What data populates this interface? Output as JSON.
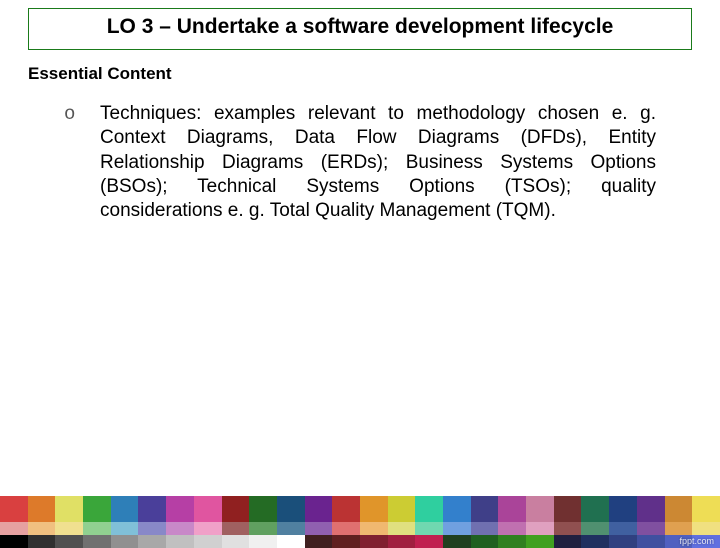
{
  "title": "LO 3 – Undertake a software development lifecycle",
  "subheading": "Essential Content",
  "bullet_marker": "o",
  "bullet_text": "Techniques: examples relevant to methodology chosen e. g. Context Diagrams, Data Flow Diagrams (DFDs), Entity Relationship Diagrams (ERDs); Business Systems Options (BSOs); Technical Systems Options (TSOs); quality considerations e. g. Total Quality Management (TQM).",
  "watermark": "fppt.com",
  "footer_rows": {
    "big": [
      "#d94040",
      "#dd7a2a",
      "#e0e065",
      "#3aa63a",
      "#2e7fb8",
      "#4a3f9a",
      "#b63fa5",
      "#e055a0",
      "#902020",
      "#246b24",
      "#1a4f7a",
      "#6a238f",
      "#bb3333",
      "#e0952a",
      "#cccc33",
      "#2fcf9f",
      "#3380cc",
      "#3f3f88",
      "#aa4499",
      "#c97fa0",
      "#703030",
      "#207050",
      "#204080",
      "#60308a",
      "#cc8833",
      "#eedd55"
    ],
    "small1": [
      "#e6a0a0",
      "#f0c080",
      "#f0e090",
      "#90d090",
      "#80c0d8",
      "#8888c8",
      "#c888c8",
      "#f0a0c8",
      "#a06060",
      "#60a060",
      "#5080a0",
      "#9060b0",
      "#e07070",
      "#f0b870",
      "#e0e080",
      "#70d8b0",
      "#70a0e0",
      "#7070b0",
      "#c070b0",
      "#e0a0c0",
      "#905050",
      "#509070",
      "#4060a0",
      "#8050a0",
      "#e0a050",
      "#f0e080"
    ],
    "small2": [
      "#000000",
      "#303030",
      "#505050",
      "#707070",
      "#909090",
      "#a8a8a8",
      "#c0c0c0",
      "#d0d0d0",
      "#e0e0e0",
      "#f0f0f0",
      "#ffffff",
      "#402020",
      "#602020",
      "#802030",
      "#a02040",
      "#c02050",
      "#204020",
      "#206020",
      "#308020",
      "#40a020",
      "#202040",
      "#203060",
      "#304080",
      "#4050a0",
      "#5060c0",
      "#6070e0"
    ]
  }
}
